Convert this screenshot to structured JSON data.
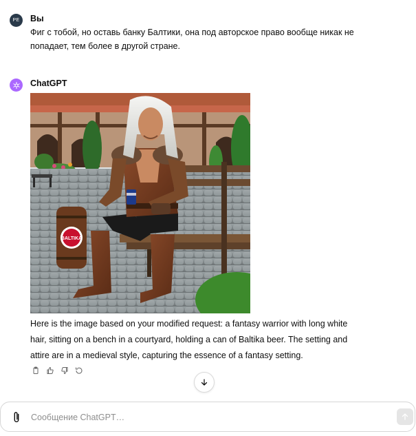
{
  "user_message": {
    "avatar_initials": "PE",
    "author": "Вы",
    "text": "Фиг с тобой, но оставь банку Балтики, она под авторское право вообще никак не попадает, тем более в другой стране."
  },
  "assistant_message": {
    "author": "ChatGPT",
    "image": {
      "barrel_label": "BALTIKA"
    },
    "text": "Here is the image based on your modified request: a fantasy warrior with long white hair, sitting on a bench in a courtyard, holding a can of Baltika beer. The setting and attire are in a medieval style, capturing the essence of a fantasy setting.",
    "actions": [
      "copy-icon",
      "thumbs-up-icon",
      "thumbs-down-icon",
      "regenerate-icon"
    ]
  },
  "composer": {
    "placeholder": "Сообщение ChatGPT…",
    "value": ""
  },
  "colors": {
    "assistant_avatar": "#ab68ff",
    "user_avatar": "#2a3a4a",
    "barrel_label_red": "#c8102e"
  }
}
